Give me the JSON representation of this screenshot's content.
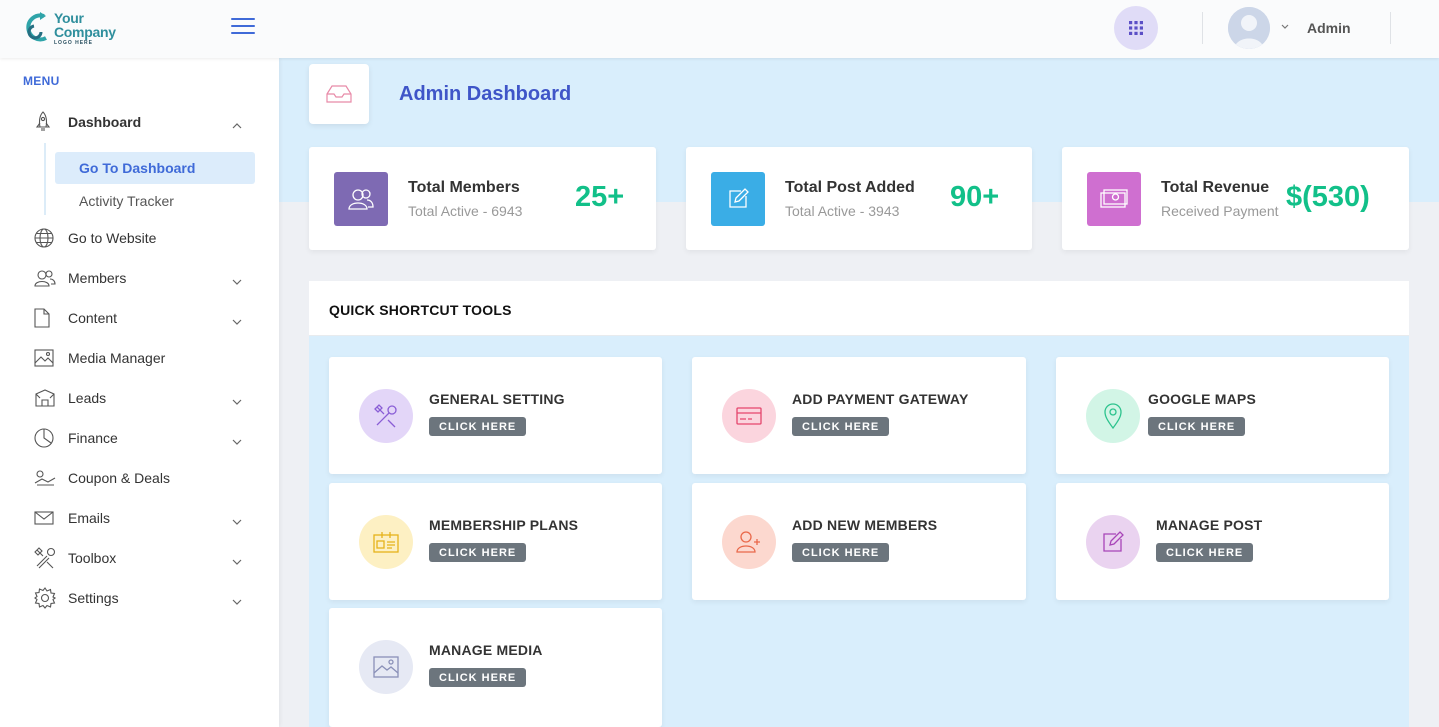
{
  "header": {
    "logo_name": "Your Company",
    "logo_sub": "LOGO HERE",
    "user_name": "Admin"
  },
  "sidebar": {
    "menu_heading": "MENU",
    "items": [
      {
        "label": "Dashboard",
        "icon": "rocket-icon"
      },
      {
        "label": "Go to Website",
        "icon": "globe-icon"
      },
      {
        "label": "Members",
        "icon": "users-icon"
      },
      {
        "label": "Content",
        "icon": "file-icon"
      },
      {
        "label": "Media Manager",
        "icon": "image-icon"
      },
      {
        "label": "Leads",
        "icon": "box-icon"
      },
      {
        "label": "Finance",
        "icon": "pie-chart-icon"
      },
      {
        "label": "Coupon & Deals",
        "icon": "coupon-icon"
      },
      {
        "label": "Emails",
        "icon": "mail-icon"
      },
      {
        "label": "Toolbox",
        "icon": "tools-icon"
      },
      {
        "label": "Settings",
        "icon": "gear-icon"
      }
    ],
    "sub_items": [
      {
        "label": "Go To Dashboard"
      },
      {
        "label": "Activity Tracker"
      }
    ]
  },
  "main": {
    "page_title": "Admin Dashboard",
    "stats": [
      {
        "title": "Total Members",
        "subtitle": "Total Active - 6943",
        "value": "25+",
        "color": "#7e6ab3"
      },
      {
        "title": "Total Post Added",
        "subtitle": "Total Active - 3943",
        "value": "90+",
        "color": "#3aade6"
      },
      {
        "title": "Total Revenue",
        "subtitle": "Received Payment",
        "value": "$(530)",
        "color": "#cf6fd0"
      }
    ],
    "shortcut_heading": "QUICK SHORTCUT TOOLS",
    "button_label": "CLICK HERE",
    "tools": [
      {
        "title": "GENERAL SETTING",
        "icon": "tools-icon",
        "bg": "#e3d6f8",
        "fg": "#8a5ed6"
      },
      {
        "title": "ADD PAYMENT GATEWAY",
        "icon": "credit-card-icon",
        "bg": "#fbd5de",
        "fg": "#e5466d"
      },
      {
        "title": "GOOGLE MAPS",
        "icon": "map-pin-icon",
        "bg": "#d2f5e6",
        "fg": "#2cc38d"
      },
      {
        "title": "MEMBERSHIP PLANS",
        "icon": "id-card-icon",
        "bg": "#fdf0c3",
        "fg": "#e6b21a"
      },
      {
        "title": "ADD NEW MEMBERS",
        "icon": "user-plus-icon",
        "bg": "#fcd8cf",
        "fg": "#e9684a"
      },
      {
        "title": "MANAGE POST",
        "icon": "edit-icon",
        "bg": "#ead3f0",
        "fg": "#a845b8"
      },
      {
        "title": "MANAGE MEDIA",
        "icon": "image-icon",
        "bg": "#e6e9f4",
        "fg": "#8a90b8"
      }
    ]
  }
}
